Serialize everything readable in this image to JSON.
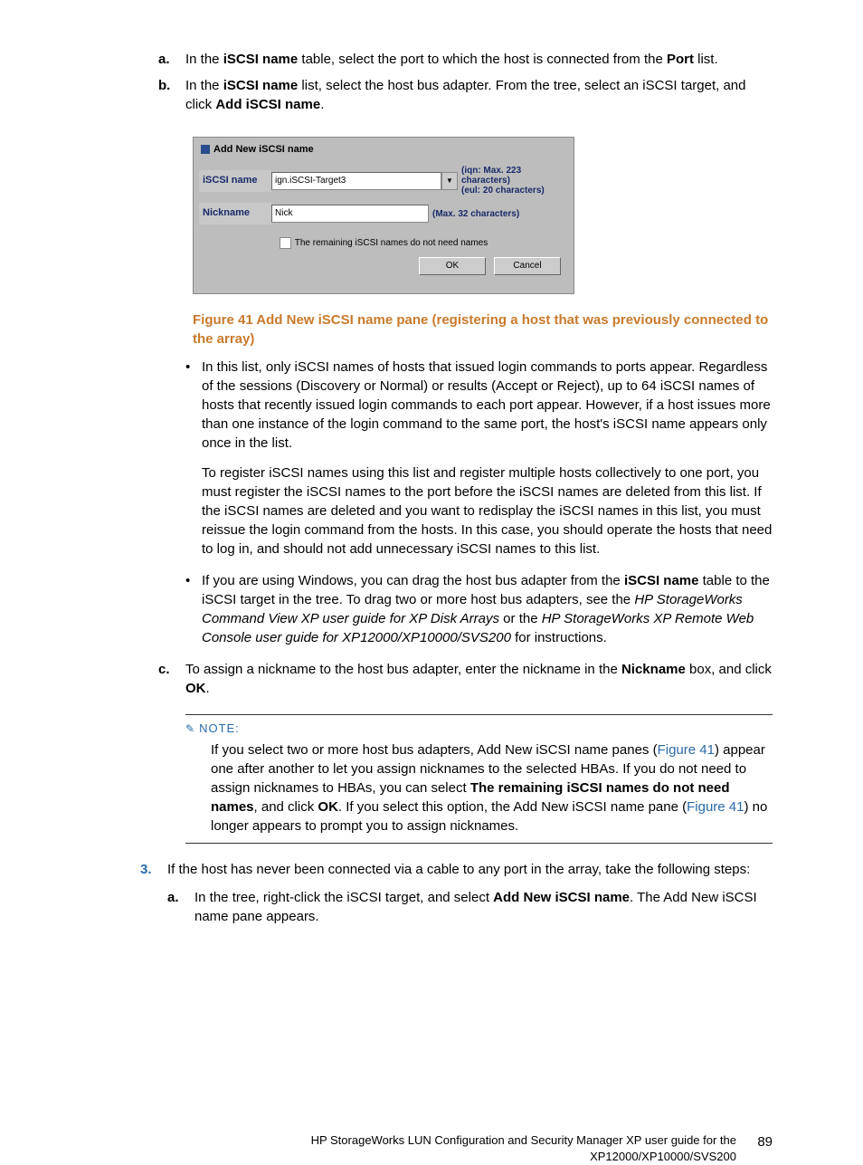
{
  "steps": {
    "a": {
      "marker": "a.",
      "pre": "In the ",
      "bold1": "iSCSI name",
      "mid": " table, select the port to which the host is connected from the ",
      "bold2": "Port",
      "post": " list."
    },
    "b": {
      "marker": "b.",
      "pre": "In the ",
      "bold1": "iSCSI name",
      "mid": " list, select the host bus adapter. From the tree, select an iSCSI target, and click ",
      "bold2": "Add iSCSI name",
      "post": "."
    },
    "c": {
      "marker": "c.",
      "pre": "To assign a nickname to the host bus adapter, enter the nickname in the ",
      "bold1": "Nickname",
      "mid": " box, and click ",
      "bold2": "OK",
      "post": "."
    }
  },
  "screenshot": {
    "title": "Add New iSCSI name",
    "row1_label": "iSCSI name",
    "row1_value": "ign.iSCSI-Target3",
    "row1_hint1": "(iqn: Max. 223 characters)",
    "row1_hint2": "(eul: 20 characters)",
    "row2_label": "Nickname",
    "row2_value": "Nick",
    "row2_hint": "(Max. 32 characters)",
    "checkbox_label": "The remaining iSCSI names do not need names",
    "ok": "OK",
    "cancel": "Cancel"
  },
  "figure_caption": "Figure 41 Add New iSCSI name pane (registering a host that was previously connected to the array)",
  "bullets": {
    "b1p1": "In this list, only iSCSI names of hosts that issued login commands to ports appear. Regardless of the sessions (Discovery or Normal) or results (Accept or Reject), up to 64 iSCSI names of hosts that recently issued login commands to each port appear. However, if a host issues more than one instance of the login command to the same port, the host's iSCSI name appears only once in the list.",
    "b1p2": "To register iSCSI names using this list and register multiple hosts collectively to one port, you must register the iSCSI names to the port before the iSCSI names are deleted from this list. If the iSCSI names are deleted and you want to redisplay the iSCSI names in this list, you must reissue the login command from the hosts. In this case, you should operate the hosts that need to log in, and should not add unnecessary iSCSI names to this list.",
    "b2_pre": "If you are using Windows, you can drag the host bus adapter from the ",
    "b2_bold": "iSCSI name",
    "b2_mid": " table to the iSCSI target in the tree. To drag two or more host bus adapters, see the ",
    "b2_it1": "HP StorageWorks Command View XP user guide for XP Disk Arrays",
    "b2_or": " or the ",
    "b2_it2": "HP StorageWorks XP Remote Web Console user guide for XP12000/XP10000/SVS200",
    "b2_post": " for instructions."
  },
  "note": {
    "label": "NOTE:",
    "pre": "If you select two or more host bus adapters, Add New iSCSI name panes (",
    "link1": "Figure 41",
    "mid1": ") appear one after another to let you assign nicknames to the selected HBAs. If you do not need to assign nicknames to HBAs, you can select ",
    "bold1": "The remaining iSCSI names do not need names",
    "mid2": ", and click ",
    "bold2": "OK",
    "mid3": ". If you select this option, the Add New iSCSI name pane (",
    "link2": "Figure 41",
    "post": ") no longer appears to prompt you to assign nicknames."
  },
  "step3": {
    "marker": "3.",
    "text": "If the host has never been connected via a cable to any port in the array, take the following steps:",
    "sub_a_marker": "a.",
    "sub_a_pre": "In the tree, right-click the iSCSI target, and select ",
    "sub_a_bold": "Add New iSCSI name",
    "sub_a_post": ". The Add New iSCSI name pane appears."
  },
  "footer": {
    "line1": "HP StorageWorks LUN Configuration and Security Manager XP user guide for the",
    "line2": "XP12000/XP10000/SVS200",
    "page": "89"
  }
}
